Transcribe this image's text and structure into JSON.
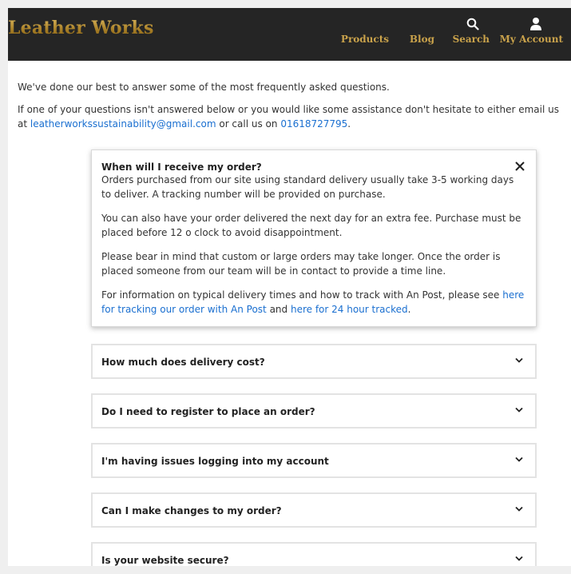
{
  "header": {
    "logo": "Leather Works",
    "nav": [
      {
        "label": "Products"
      },
      {
        "label": "Blog"
      },
      {
        "label": "Search",
        "icon": "search-icon"
      },
      {
        "label": "My Account",
        "icon": "user-icon"
      }
    ]
  },
  "intro": {
    "line1": "We've done our best to answer some of the most frequently asked questions.",
    "line2_a": "If one of your questions isn't answered below or you would like some assistance don't hesitate to either email us at ",
    "email": "leatherworkssustainability@gmail.com",
    "line2_b": " or call us on ",
    "phone": "01618727795",
    "line2_c": "."
  },
  "faq_open": {
    "question": "When will I receive my order?",
    "p1": "Orders purchased from our site using standard delivery usually take 3-5 working days to deliver. A tracking number will be provided on purchase.",
    "p2": "You can also have your order delivered the next day for an extra fee. Purchase must be placed before 12 o clock to avoid disappointment.",
    "p3": "Please bear in mind that custom or large orders may take longer. Once the order is placed someone from our team will be in contact to provide a time line.",
    "p4_a": "For information on typical delivery times and how to track with An Post, please see ",
    "p4_link1": "here for tracking our order with An Post",
    "p4_b": " and ",
    "p4_link2": "here for 24 hour tracked",
    "p4_c": "."
  },
  "faq_closed": [
    {
      "question": "How much does delivery cost?"
    },
    {
      "question": "Do I need to register to place an order?"
    },
    {
      "question": "I'm having issues logging into my account"
    },
    {
      "question": "Can I make changes to my order?"
    },
    {
      "question": "Is your website secure?"
    }
  ],
  "colors": {
    "header_bg": "#252525",
    "gold": "#c9a24b",
    "link": "#1a6fd0"
  }
}
